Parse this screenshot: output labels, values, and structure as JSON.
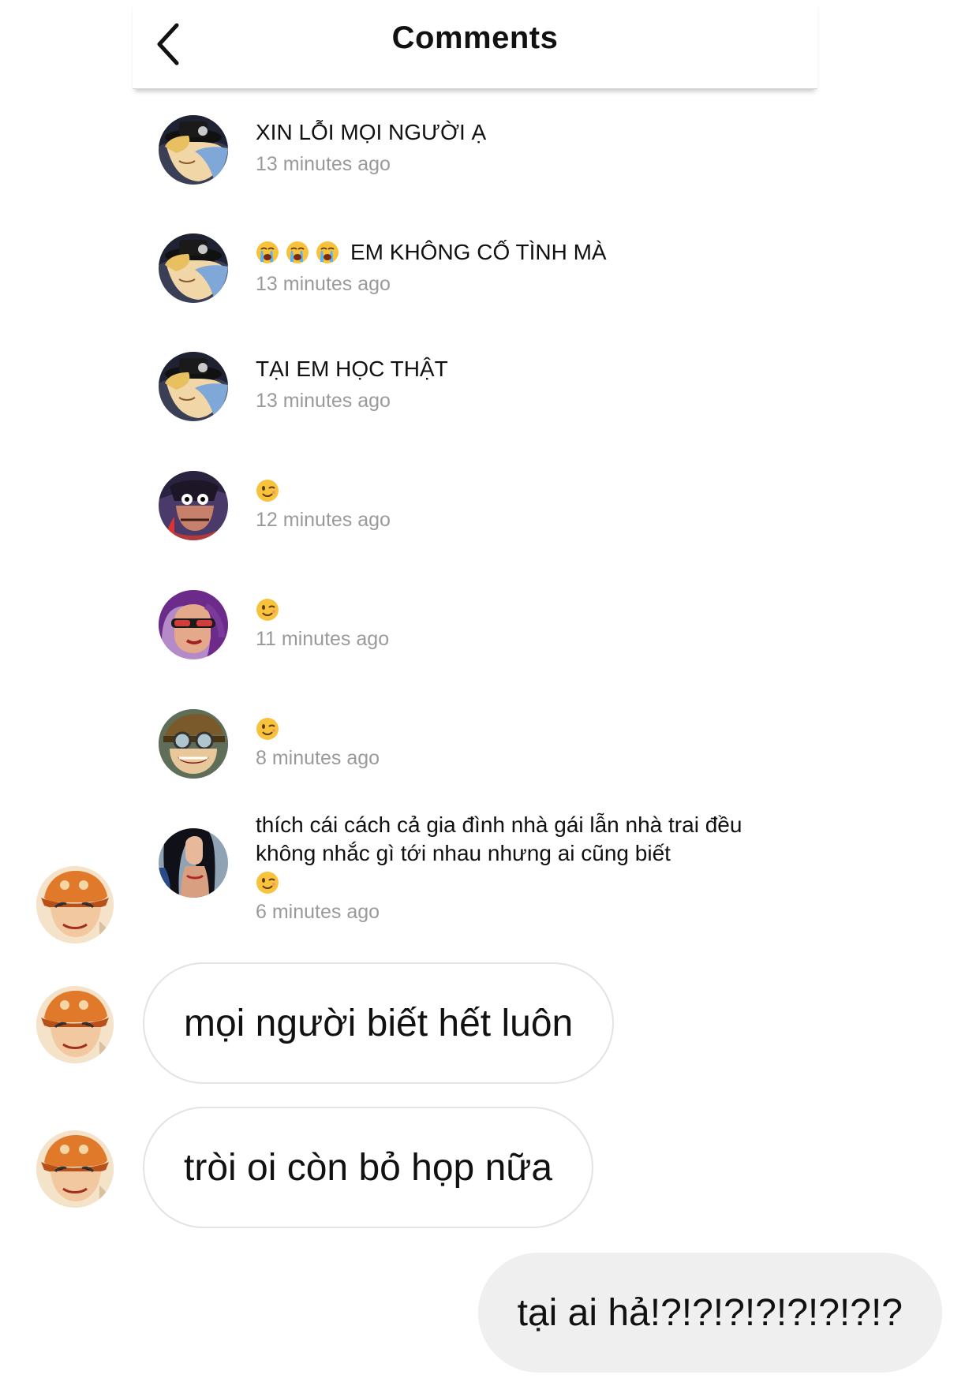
{
  "card": {
    "title": "Comments",
    "comments": [
      {
        "text": "XIN LỖI MỌI NGƯỜI Ạ",
        "time": "13 minutes ago",
        "avatar": "sabo-avatar",
        "emojis": []
      },
      {
        "text": "EM KHÔNG CỐ TÌNH MÀ",
        "time": "13 minutes ago",
        "avatar": "sabo-avatar",
        "emojis": [
          "crying-emoji",
          "crying-emoji",
          "crying-emoji"
        ]
      },
      {
        "text": "TẠI EM HỌC THẬT",
        "time": "13 minutes ago",
        "avatar": "sabo-avatar",
        "emojis": []
      },
      {
        "text": "",
        "time": "12 minutes ago",
        "avatar": "pirate-avatar",
        "emojis": [
          "winking-emoji"
        ]
      },
      {
        "text": "",
        "time": "11 minutes ago",
        "avatar": "purple-hair-avatar",
        "emojis": [
          "winking-emoji"
        ]
      },
      {
        "text": "",
        "time": "8 minutes ago",
        "avatar": "goggles-avatar",
        "emojis": [
          "winking-emoji"
        ]
      },
      {
        "text": "thích cái cách cả gia đình nhà gái lẫn nhà trai đều không nhắc gì tới nhau nhưng ai cũng biết",
        "time": "6 minutes ago",
        "avatar": "dark-hair-avatar",
        "emojis": [
          "winking-emoji"
        ]
      }
    ]
  },
  "chat": {
    "incoming": [
      {
        "text": "mọi người biết hết luôn",
        "avatar": "ace-avatar"
      },
      {
        "text": "tròi oi còn bỏ họp nữa",
        "avatar": "ace-avatar"
      }
    ],
    "outgoing": [
      {
        "text": "tại ai hả!?!?!?!?!?!?!?!?"
      }
    ]
  },
  "colors": {
    "timestamp": "#9a9a9a",
    "outgoing_bubble": "#efefef",
    "incoming_border": "#e3e3e3",
    "emoji_face": "#f9c23c"
  }
}
